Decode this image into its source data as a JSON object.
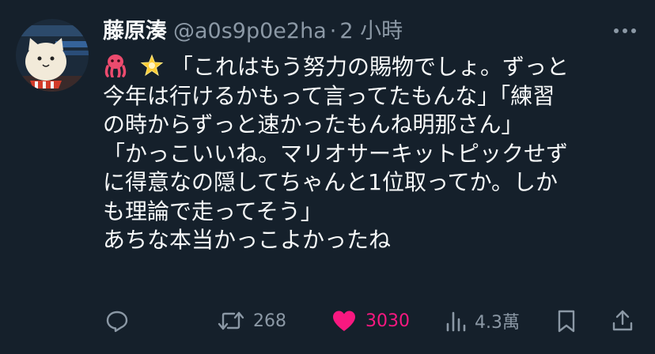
{
  "tweet": {
    "display_name": "藤原湊",
    "handle": "@a0s9p0e2ha",
    "separator": "·",
    "time": "2 小時",
    "lines": [
      "「これはもう努力の賜物でしょ。ずっと",
      "今年は行けるかもって言ってたもんな」「練習",
      "の時からずっと速かったもんね明那さん」",
      "「かっこいいね。マリオサーキットピックせず",
      "に得意なの隠してちゃんと1位取ってか。しか",
      "も理論で走ってそう」",
      "あちな本当かっこよかったね"
    ],
    "emojis": [
      "octopus-emoji",
      "glowing-star-emoji"
    ]
  },
  "actions": {
    "reply_count": "",
    "retweet_count": "268",
    "like_count": "3030",
    "views_count": "4.3萬"
  },
  "colors": {
    "background": "#15202b",
    "text": "#f7f9f9",
    "secondary": "#8b98a5",
    "like": "#f91880"
  }
}
